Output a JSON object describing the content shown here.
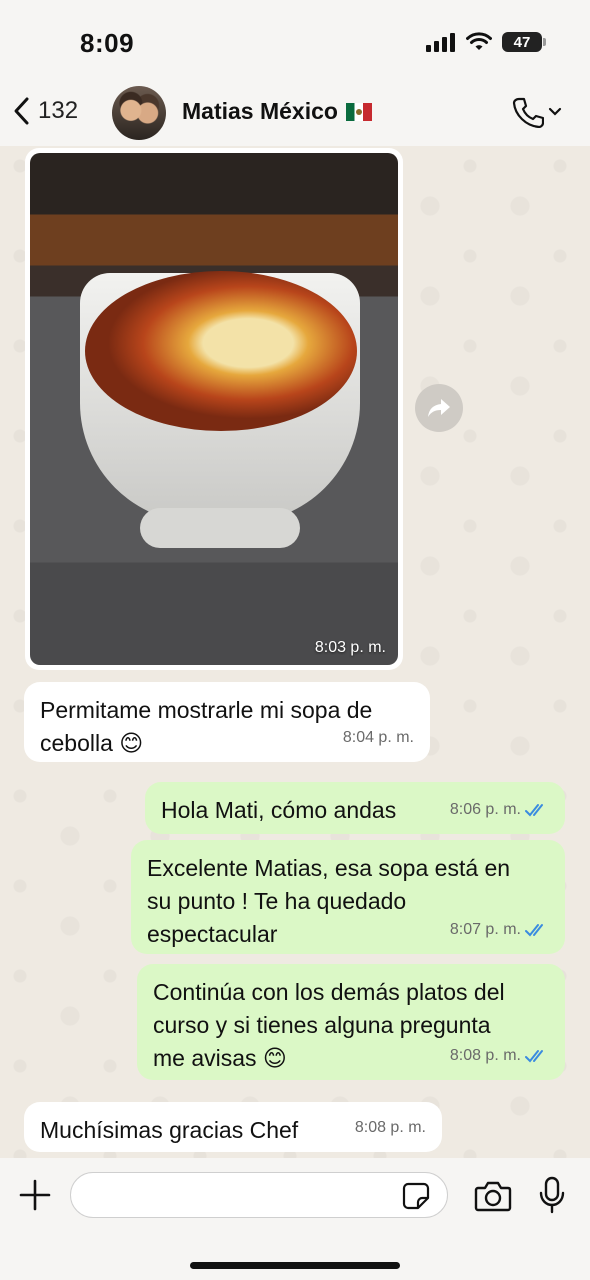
{
  "status": {
    "time": "8:09",
    "battery": "47"
  },
  "header": {
    "back_count": "132",
    "contact_name": "Matias México",
    "flag": "mexico-flag-icon"
  },
  "messages": [
    {
      "type": "image",
      "direction": "in",
      "time": "8:03 p. m."
    },
    {
      "type": "text",
      "direction": "in",
      "text_lines": [
        "Permitame mostrarle mi sopa de",
        "cebolla 😊"
      ],
      "time": "8:04 p. m."
    },
    {
      "type": "text",
      "direction": "out",
      "text_lines": [
        "Hola Mati, cómo andas"
      ],
      "time": "8:06 p. m.",
      "read": true
    },
    {
      "type": "text",
      "direction": "out",
      "text_lines": [
        "Excelente Matias, esa sopa está en",
        "su punto ! Te ha quedado",
        "espectacular"
      ],
      "time": "8:07 p. m.",
      "read": true
    },
    {
      "type": "text",
      "direction": "out",
      "text_lines": [
        "Continúa con los demás platos del",
        "curso y si tienes alguna pregunta",
        "me avisas 😊"
      ],
      "time": "8:08 p. m.",
      "read": true
    },
    {
      "type": "text",
      "direction": "in",
      "text_lines": [
        "Muchísimas gracias Chef"
      ],
      "time": "8:08 p. m."
    }
  ],
  "input": {
    "placeholder": ""
  },
  "colors": {
    "outgoing_bubble": "#dbf8c6",
    "incoming_bubble": "#ffffff",
    "read_ticks": "#3a8be0",
    "chat_background": "#efeae2"
  }
}
